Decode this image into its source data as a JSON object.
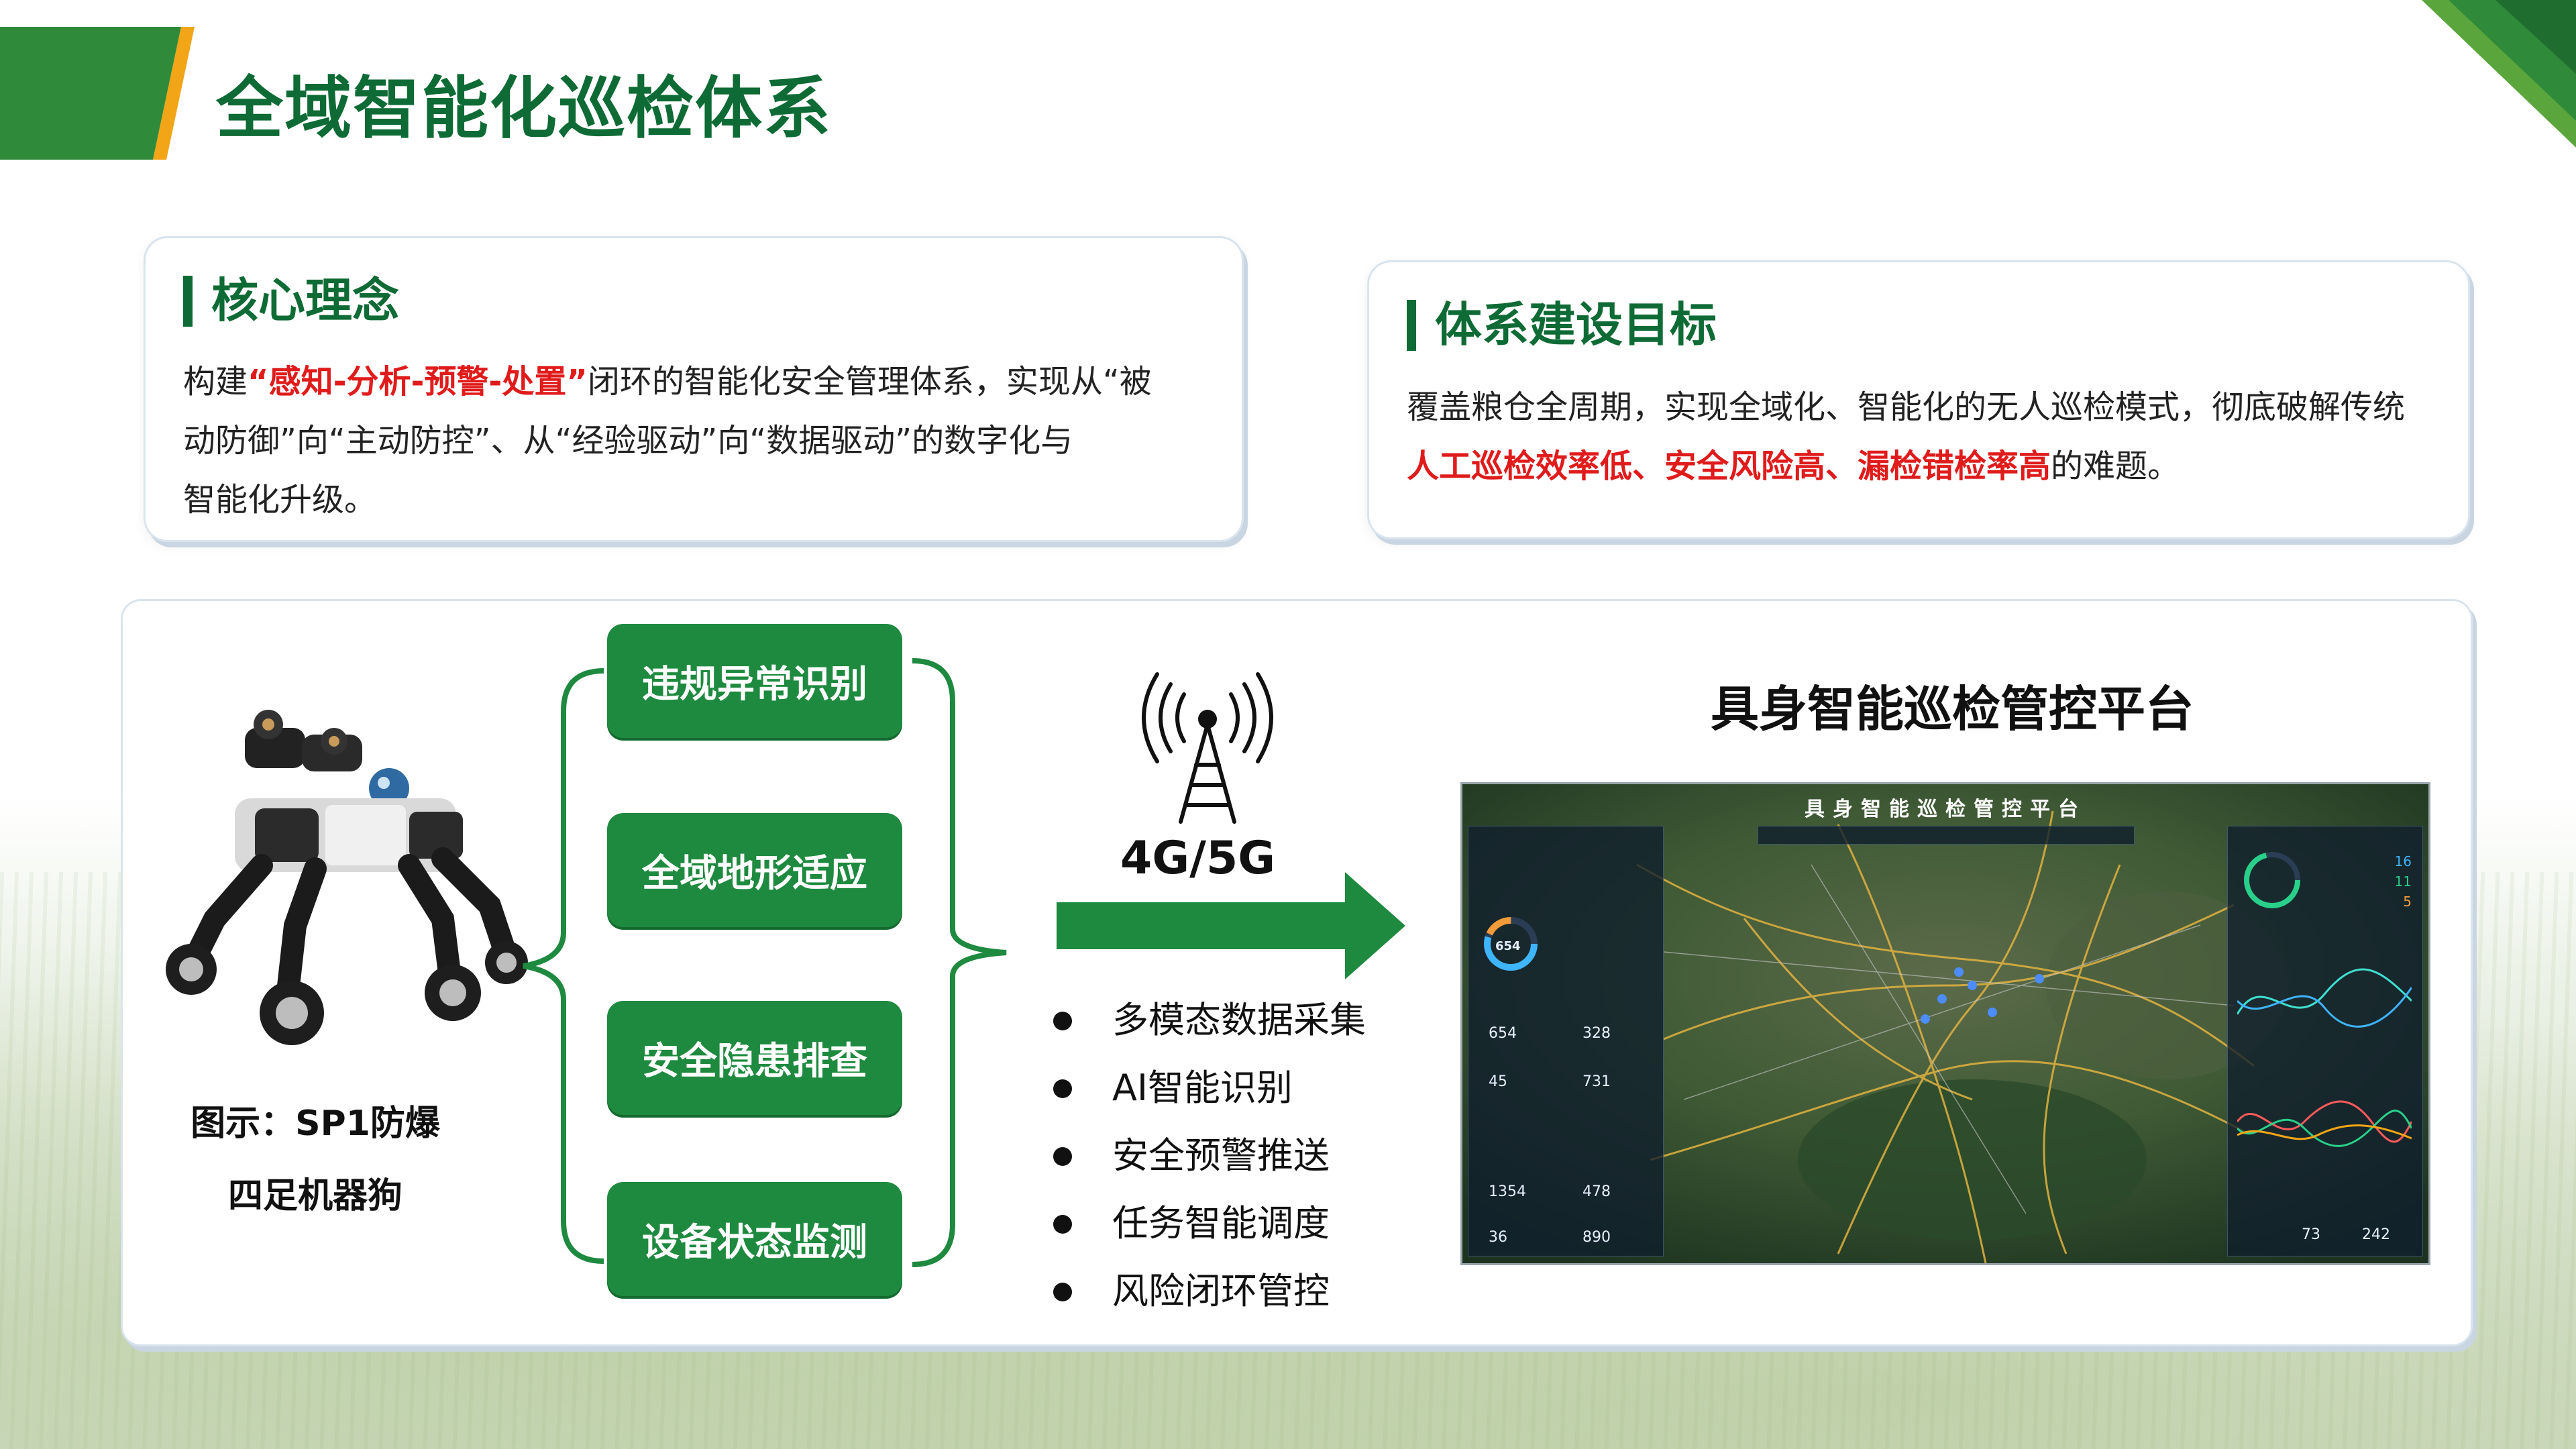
{
  "header": {
    "title": "全域智能化巡检体系"
  },
  "core": {
    "title": "核心理念",
    "line1_pre": "构建",
    "line1_red": "“感知-分析-预警-处置”",
    "line1_post": "闭环的智能化安全管理体系，实现从“被",
    "line2": "动防御”向“主动防控”、从“经验驱动”向“数据驱动”的数字化与",
    "line3": "智能化升级。"
  },
  "goal": {
    "title": "体系建设目标",
    "line1": "覆盖粮仓全周期，实现全域化、智能化的无人巡检模式，彻底破解传统",
    "line2_red": "人工巡检效率低、安全风险高、漏检错检率高",
    "line2_post": "的难题。"
  },
  "robot": {
    "caption1": "图示：SP1防爆",
    "caption2": "四足机器狗"
  },
  "functions": [
    "违规异常识别",
    "全域地形适应",
    "安全隐患排查",
    "设备状态监测"
  ],
  "network": {
    "label": "4G/5G"
  },
  "features": [
    "多模态数据采集",
    "AI智能识别",
    "安全预警推送",
    "任务智能调度",
    "风险闭环管控"
  ],
  "platform": {
    "title": "具身智能巡检管控平台",
    "screen_title": "具身智能巡检管控平台",
    "stats_left": [
      "654",
      "328",
      "45",
      "731",
      "1354",
      "478",
      "36",
      "890"
    ],
    "stats_right": [
      "16",
      "11",
      "5",
      "73",
      "242"
    ]
  },
  "colors": {
    "brand_green": "#0f6b35",
    "button_green": "#1e8a3f",
    "accent_orange": "#f2a516",
    "highlight_red": "#e01b1b"
  }
}
